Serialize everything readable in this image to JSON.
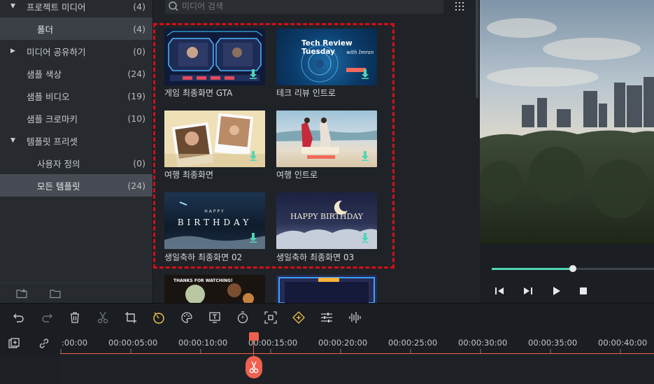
{
  "sidebar": {
    "items": [
      {
        "label": "프로젝트 미디어",
        "count": "(4)",
        "expanded": true
      },
      {
        "label": "폴더",
        "count": "(4)"
      },
      {
        "label": "미디어 공유하기",
        "count": "(0)",
        "expanded": false
      },
      {
        "label": "샘플 색상",
        "count": "(24)"
      },
      {
        "label": "샘플 비디오",
        "count": "(19)"
      },
      {
        "label": "샘플 크로마키",
        "count": "(10)"
      },
      {
        "label": "템플릿 프리셋",
        "count": "",
        "expanded": true
      },
      {
        "label": "사용자 정의",
        "count": "(0)"
      },
      {
        "label": "모든 템플릿",
        "count": "(24)"
      }
    ]
  },
  "search": {
    "placeholder": "미디어 검색"
  },
  "thumbnails": [
    {
      "label": "게임 최종화면 GTA"
    },
    {
      "label": "테크 리뷰 인트로",
      "overlay_title": "Tech Review Tuesday",
      "overlay_sub": "with Imran"
    },
    {
      "label": "여행 최종화면"
    },
    {
      "label": "여행 인트로"
    },
    {
      "label": "생일축하 최종화면 02",
      "overlay_title": "BIRTHDAY",
      "overlay_small": "HAPPY"
    },
    {
      "label": "생일축하 최종화면 03",
      "overlay_title": "HAPPY BIRTHDAY"
    },
    {
      "label": "",
      "overlay_title": "THANKS FOR WATCHING!"
    },
    {
      "label": ""
    }
  ],
  "preview": {
    "progress": 0.5
  },
  "timeline": {
    "ticks": [
      ":00:00",
      "00:00:05:00",
      "00:00:10:00",
      "00:00:15:00",
      "00:00:20:00",
      "00:00:25:00",
      "00:00:30:00",
      "00:00:35:00",
      "00:00:40:00"
    ]
  },
  "colors": {
    "accent": "#4fd6b4",
    "selection": "#d40f1a",
    "playhead": "#f0604e",
    "highlight": "#f3c94a"
  }
}
